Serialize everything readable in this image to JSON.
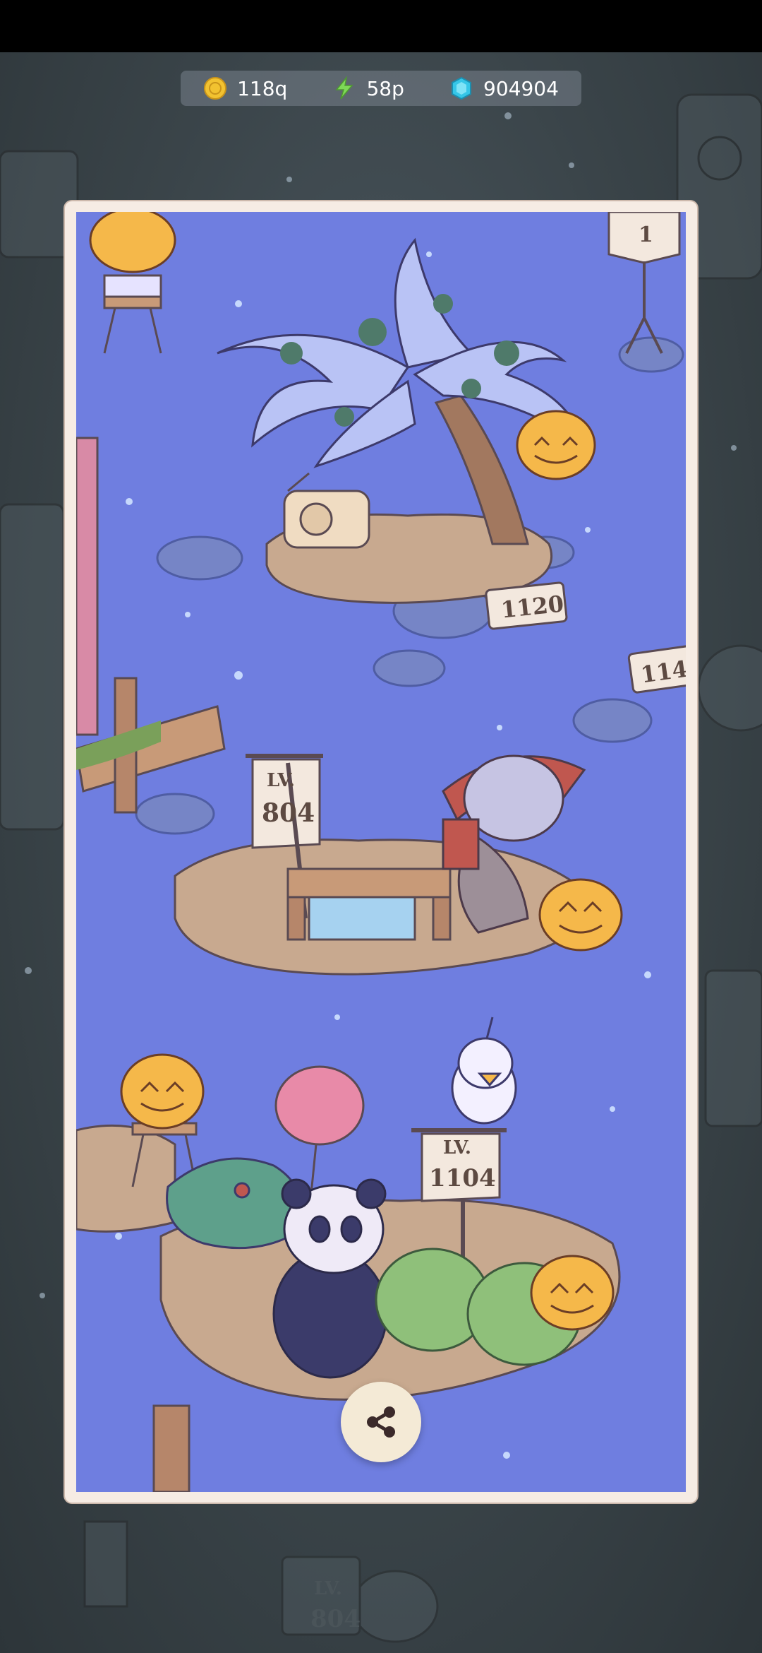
{
  "resources": {
    "coins": {
      "icon": "coin-icon",
      "value": "118q"
    },
    "energy": {
      "icon": "lightning-icon",
      "value": "58p"
    },
    "gems": {
      "icon": "gem-icon",
      "value": "904904"
    }
  },
  "signs": {
    "level_one": "1",
    "score_1120": "1120",
    "score_114": "114",
    "lv_prefix": "LV.",
    "lv_804": "804",
    "lv_1104": "1104",
    "bg_lv_prefix": "LV.",
    "bg_lv_804": "804"
  },
  "share": {
    "icon": "share-icon"
  },
  "colors": {
    "scene_bg": "#6f7ee0",
    "frame": "#f6ece4",
    "pumpkin": "#f5b84a",
    "coin": "#f2c230",
    "energy": "#7ed957",
    "gem": "#35c6e8"
  }
}
